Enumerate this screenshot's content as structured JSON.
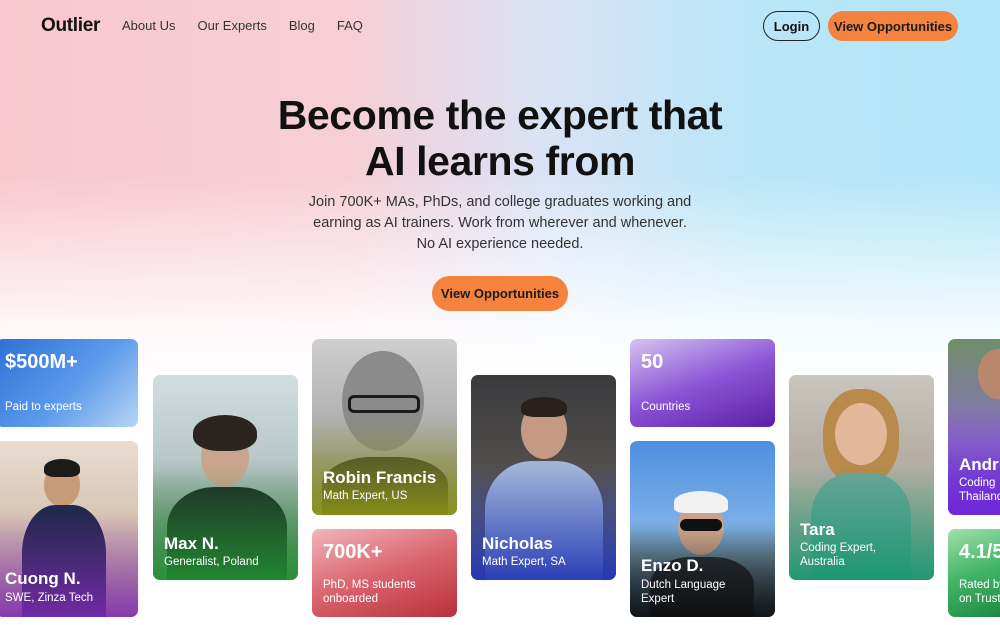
{
  "nav": {
    "logo": "Outlier",
    "links": [
      "About Us",
      "Our Experts",
      "Blog",
      "FAQ"
    ],
    "login_label": "Login",
    "cta_label": "View Opportunities"
  },
  "hero": {
    "title_line1": "Become the expert that",
    "title_line2": "AI learns from",
    "subtitle_line1": "Join 700K+ MAs, PhDs, and college graduates working and",
    "subtitle_line2": "earning as AI trainers. Work from wherever and whenever.",
    "subtitle_line3": "No AI experience needed.",
    "cta_label": "View Opportunities"
  },
  "stats": [
    {
      "value": "$500M+",
      "label": "Paid to experts"
    },
    {
      "value": "700K+",
      "label_line1": "PhD, MS students",
      "label_line2": "onboarded"
    },
    {
      "value": "50",
      "label": "Countries"
    },
    {
      "value": "4.1/5",
      "label_line1": "Rated by",
      "label_line2": "on Trust"
    }
  ],
  "experts": [
    {
      "name": "Cuong N.",
      "role": "SWE, Zinza Tech"
    },
    {
      "name": "Max N.",
      "role": "Generalist, Poland"
    },
    {
      "name": "Robin Francis",
      "role": "Math Expert, US"
    },
    {
      "name": "Nicholas",
      "role": "Math Expert, SA"
    },
    {
      "name": "Enzo D.",
      "role_line1": "Dutch Language",
      "role_line2": "Expert"
    },
    {
      "name": "Tara",
      "role_line1": "Coding Expert,",
      "role_line2": "Australia"
    },
    {
      "name": "Andr",
      "role_line1": "Coding",
      "role_line2": "Thailand"
    }
  ],
  "colors": {
    "accent": "#f5833e",
    "stat_blue": "#4a8ee8",
    "stat_red": "#c9434e",
    "stat_purple": "#6a2ab8",
    "stat_green": "#2f9b54"
  }
}
